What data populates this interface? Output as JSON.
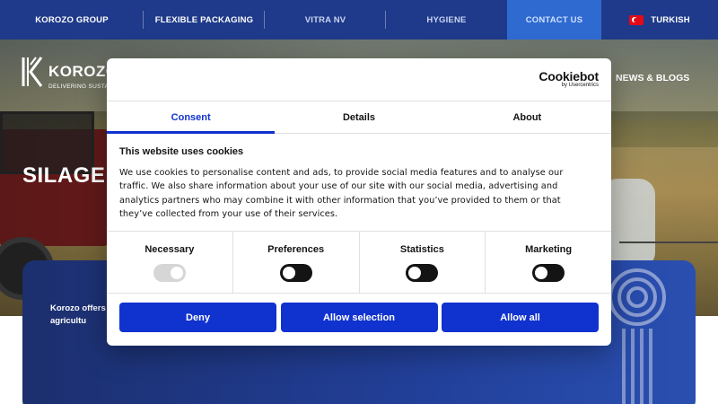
{
  "topbar": {
    "items": [
      {
        "label": "KOROZO GROUP"
      },
      {
        "label": "FLEXIBLE PACKAGING"
      },
      {
        "label": "VITRA NV"
      },
      {
        "label": "HYGIENE"
      },
      {
        "label": "CONTACT US"
      },
      {
        "label": "TURKISH"
      }
    ]
  },
  "header": {
    "logo_text": "KOROZO",
    "tagline": "DELIVERING SUSTA",
    "nav_news": "NEWS & BLOGS"
  },
  "hero": {
    "title": "SILAGE F"
  },
  "card": {
    "text": "Korozo offers the agricultu"
  },
  "cookie_dialog": {
    "brand_name": "Cookiebot",
    "brand_sub": "by Usercentrics",
    "tabs": [
      {
        "label": "Consent"
      },
      {
        "label": "Details"
      },
      {
        "label": "About"
      }
    ],
    "title": "This website uses cookies",
    "body": "We use cookies to personalise content and ads, to provide social media features and to analyse our traffic. We also share information about your use of our site with our social media, advertising and analytics partners who may combine it with other information that you’ve provided to them or that they’ve collected from your use of their services.",
    "categories": [
      {
        "label": "Necessary",
        "enabled": true
      },
      {
        "label": "Preferences",
        "enabled": false
      },
      {
        "label": "Statistics",
        "enabled": false
      },
      {
        "label": "Marketing",
        "enabled": false
      }
    ],
    "buttons": {
      "deny": "Deny",
      "allow_selection": "Allow selection",
      "allow_all": "Allow all"
    }
  },
  "colors": {
    "topbar": "#1f3a8a",
    "accent": "#1032cf",
    "card": "#22409a"
  }
}
